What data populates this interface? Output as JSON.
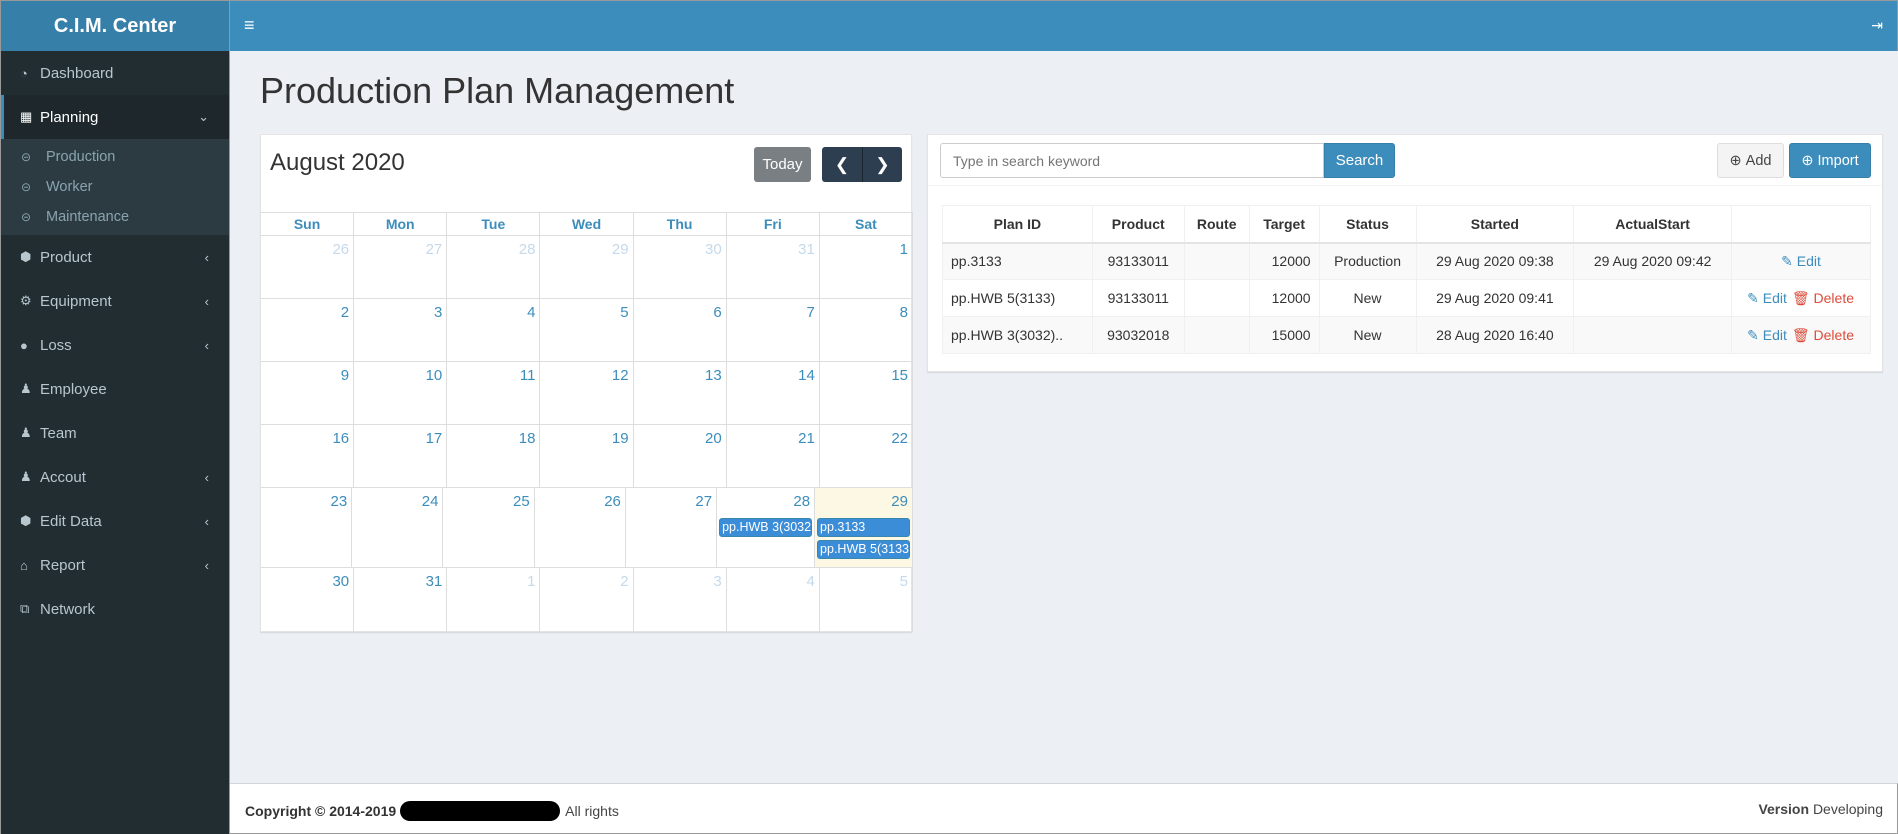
{
  "app": {
    "title": "C.I.M. Center"
  },
  "sidebar": {
    "items": [
      {
        "label": "Dashboard",
        "icon": "dashboard-icon"
      },
      {
        "label": "Planning",
        "icon": "calendar-icon"
      },
      {
        "label": "Product",
        "icon": "cube-icon"
      },
      {
        "label": "Equipment",
        "icon": "cogs-icon"
      },
      {
        "label": "Loss",
        "icon": "exclamation-circle-icon"
      },
      {
        "label": "Employee",
        "icon": "user-icon"
      },
      {
        "label": "Team",
        "icon": "users-icon"
      },
      {
        "label": "Accout",
        "icon": "user-plus-icon"
      },
      {
        "label": "Edit Data",
        "icon": "cube-icon"
      },
      {
        "label": "Report",
        "icon": "bank-icon"
      },
      {
        "label": "Network",
        "icon": "sitemap-icon"
      }
    ],
    "submenu": [
      "Production",
      "Worker",
      "Maintenance"
    ]
  },
  "page": {
    "title": "Production Plan Management"
  },
  "calendar": {
    "month": "August 2020",
    "today_label": "Today",
    "weekdays": [
      "Sun",
      "Mon",
      "Tue",
      "Wed",
      "Thu",
      "Fri",
      "Sat"
    ],
    "weeks": [
      [
        "26",
        "27",
        "28",
        "29",
        "30",
        "31",
        "1"
      ],
      [
        "2",
        "3",
        "4",
        "5",
        "6",
        "7",
        "8"
      ],
      [
        "9",
        "10",
        "11",
        "12",
        "13",
        "14",
        "15"
      ],
      [
        "16",
        "17",
        "18",
        "19",
        "20",
        "21",
        "22"
      ],
      [
        "23",
        "24",
        "25",
        "26",
        "27",
        "28",
        "29"
      ],
      [
        "30",
        "31",
        "1",
        "2",
        "3",
        "4",
        "5"
      ]
    ],
    "events": {
      "fri28": "pp.HWB 3(3032",
      "sat29a": "pp.3133",
      "sat29b": "pp.HWB 5(3133"
    }
  },
  "search": {
    "placeholder": "Type in search keyword",
    "button": "Search"
  },
  "toolbar": {
    "add": "Add",
    "import": "Import"
  },
  "table": {
    "headers": [
      "Plan ID",
      "Product",
      "Route",
      "Target",
      "Status",
      "Started",
      "ActualStart",
      ""
    ],
    "rows": [
      {
        "plan_id": "pp.3133",
        "product": "93133011",
        "route": "",
        "target": "12000",
        "status": "Production",
        "started": "29 Aug 2020 09:38",
        "actual_start": "29 Aug 2020 09:42",
        "edit": "Edit",
        "delete": ""
      },
      {
        "plan_id": "pp.HWB 5(3133)",
        "product": "93133011",
        "route": "",
        "target": "12000",
        "status": "New",
        "started": "29 Aug 2020 09:41",
        "actual_start": "",
        "edit": "Edit",
        "delete": "Delete"
      },
      {
        "plan_id": "pp.HWB 3(3032)..",
        "product": "93032018",
        "route": "",
        "target": "15000",
        "status": "New",
        "started": "28 Aug 2020 16:40",
        "actual_start": "",
        "edit": "Edit",
        "delete": "Delete"
      }
    ]
  },
  "footer": {
    "copyright": "Copyright © 2014-2019",
    "rights": "All rights",
    "version_label": "Version",
    "version_value": "Developing"
  },
  "colors": {
    "primary": "#3c8dbc",
    "sidebar": "#222d32",
    "danger": "#dd4b39"
  }
}
